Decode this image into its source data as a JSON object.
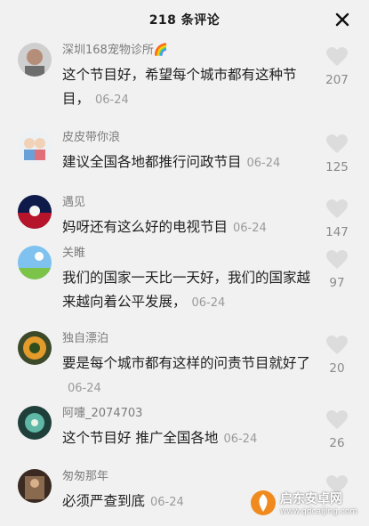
{
  "header": {
    "title": "218 条评论",
    "close_icon": "close-icon"
  },
  "comments": [
    {
      "username": "深圳168宠物诊所🌈",
      "text": "这个节目好，希望每个城市都有这种节目，",
      "date": "06-24",
      "likes": "207"
    },
    {
      "username": "皮皮带你浪",
      "text": "建议全国各地都推行问政节目",
      "date": "06-24",
      "likes": "125"
    },
    {
      "username": "遇见",
      "text": "妈呀还有这么好的电视节目",
      "date": "06-24",
      "likes": "147"
    },
    {
      "username": "关睢",
      "text": "我们的国家一天比一天好，我们的国家越来越向着公平发展，",
      "date": "06-24",
      "likes": "97"
    },
    {
      "username": "独自漂泊",
      "text": "要是每个城市都有这样的问责节目就好了",
      "date": "06-24",
      "likes": "20"
    },
    {
      "username": "阿嚏_2074703",
      "text": "这个节目好 推广全国各地",
      "date": "06-24",
      "likes": "26"
    },
    {
      "username": "匆匆那年",
      "text": "必须严查到底",
      "date": "06-24",
      "likes": ""
    }
  ],
  "watermark": {
    "name": "启东安卓网",
    "url": "www.qdcaijing.com"
  },
  "colors": {
    "background": "#f1f1f1",
    "username": "#7c7c7c",
    "text": "#1e1e1e",
    "meta": "#9a9a9a"
  }
}
